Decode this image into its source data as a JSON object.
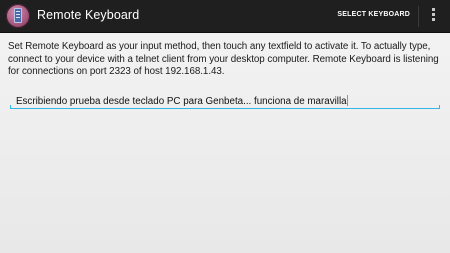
{
  "action_bar": {
    "app_icon": "remote-keyboard-app-icon",
    "title": "Remote Keyboard",
    "select_keyboard_label": "SELECT KEYBOARD",
    "overflow_icon": "overflow-menu-icon"
  },
  "main": {
    "description": "Set Remote Keyboard as your input method, then touch any textfield to activate it. To actually type, connect to your device with a telnet client from your desktop computer. Remote Keyboard is listening for connections on port 2323 of host 192.168.1.43.",
    "text_field_value": "Escribiendo prueba desde teclado PC para Genbeta... funciona de maravilla"
  },
  "colors": {
    "action_bar_bg": "#1f1f1f",
    "accent": "#33b5e5",
    "background": "#efefef"
  }
}
